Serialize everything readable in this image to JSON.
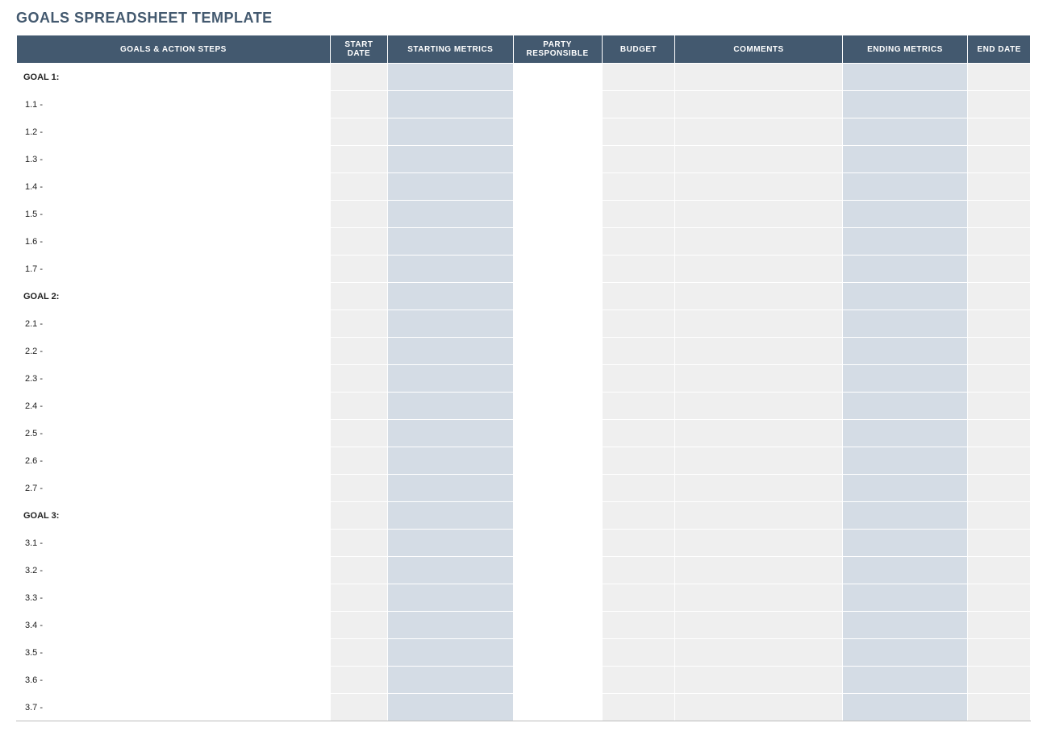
{
  "title": "GOALS SPREADSHEET TEMPLATE",
  "headers": {
    "goals": "GOALS & ACTION STEPS",
    "start_date": "START DATE",
    "starting_metrics": "STARTING METRICS",
    "party_responsible": "PARTY RESPONSIBLE",
    "budget": "BUDGET",
    "comments": "COMMENTS",
    "ending_metrics": "ENDING METRICS",
    "end_date": "END DATE"
  },
  "goals": [
    {
      "label": "GOAL 1:",
      "steps": [
        "1.1 -",
        "1.2 -",
        "1.3 -",
        "1.4 -",
        "1.5 -",
        "1.6 -",
        "1.7 -"
      ]
    },
    {
      "label": "GOAL 2:",
      "steps": [
        "2.1 -",
        "2.2 -",
        "2.3 -",
        "2.4 -",
        "2.5 -",
        "2.6 -",
        "2.7 -"
      ]
    },
    {
      "label": "GOAL 3:",
      "steps": [
        "3.1 -",
        "3.2 -",
        "3.3 -",
        "3.4 -",
        "3.5 -",
        "3.6 -",
        "3.7 -"
      ]
    }
  ]
}
